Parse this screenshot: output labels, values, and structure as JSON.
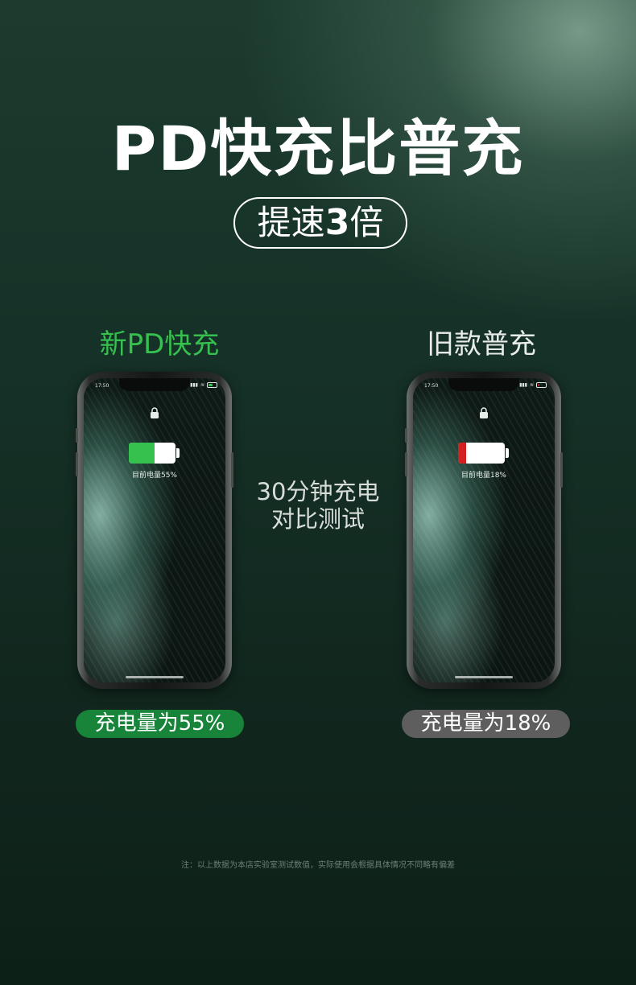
{
  "hero": {
    "title": "PD快充比普充",
    "subtitle_prefix": "提速",
    "subtitle_number": "3",
    "subtitle_suffix": "倍"
  },
  "comparison": {
    "left": {
      "label": "新PD快充",
      "phone_time": "17:50",
      "battery_caption": "目前电量55%",
      "battery_level": 0.55,
      "battery_color": "#36c04e",
      "result": "充电量为55%"
    },
    "right": {
      "label": "旧款普充",
      "phone_time": "17:50",
      "battery_caption": "目前电量18%",
      "battery_level": 0.18,
      "battery_color": "#d21f1f",
      "result": "充电量为18%"
    },
    "center_line1": "30分钟充电",
    "center_line2": "对比测试"
  },
  "footnote": "注：以上数据为本店实验室测试数值，实际使用会根据具体情况不同略有偏差",
  "colors": {
    "accent_green": "#36c04e",
    "pill_green": "#17843a",
    "pill_gray": "#5e5e5e"
  }
}
